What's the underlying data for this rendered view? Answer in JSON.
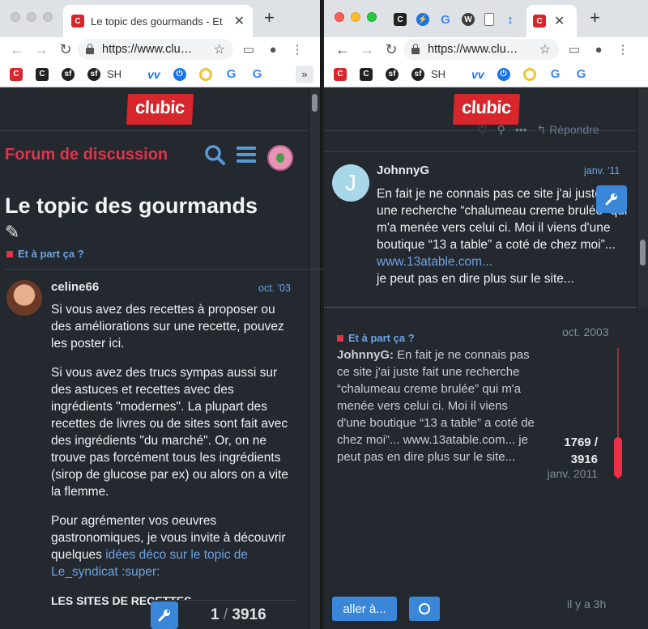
{
  "left_window": {
    "tab_title": "Le topic des gourmands - Et à",
    "url": "https://www.clu…",
    "bookmark_sh": "SH",
    "logo": "clubic",
    "forum_title": "Forum de discussion",
    "topic_title": "Le topic des gourmands",
    "category": "Et à part ça ?",
    "post": {
      "username": "celine66",
      "date": "oct. '03",
      "paragraphs": [
        "Si vous avez des recettes à proposer ou des améliorations sur une recette, pouvez les poster ici.",
        "Si vous avez des trucs sympas aussi sur des astuces et recettes avec des ingrédients \"modernes\". La plupart des recettes de livres ou de sites sont fait avec des ingrédients \"du marché\". Or, on ne trouve pas forcément tous les ingrédients (sirop de glucose par ex) ou alors on a vite la flemme."
      ],
      "p3_text": "Pour agrémenter vos oeuvres gastronomiques, je vous invite à découvrir quelques ",
      "p3_link": "idées déco sur le topic de Le_syndicat :super:",
      "sites_heading": "LES SITES DE RECETTES"
    },
    "progress_current": "1",
    "progress_total": "3916"
  },
  "right_window": {
    "url": "https://www.clu…",
    "bookmark_sh": "SH",
    "logo": "clubic",
    "reply_label": "Répondre",
    "post": {
      "avatar_letter": "J",
      "username": "JohnnyG",
      "date": "janv. '11",
      "text": "En fait je ne connais pas ce site j'ai juste fait une recherche “chalumeau creme brulée” qui m'a menée vers celui ci. Moi il viens d'une boutique “13 a table” a coté de chez moi”...",
      "link": "www.13atable.com...",
      "text2": "je peut pas en dire plus sur le site..."
    },
    "timeline": {
      "category": "Et à part ça ?",
      "start_date": "oct. 2003",
      "excerpt_user": "JohnnyG:",
      "excerpt": "En fait je ne connais pas ce site j'ai juste fait une recherche “chalumeau creme brulée” qui m'a menée vers celui ci. Moi il viens d'une boutique “13 a table” a coté de chez moi”... www.13atable.com... je peut pas en dire plus sur le site...",
      "position": "1769 / 3916",
      "current_date": "janv. 2011",
      "goto_label": "aller à...",
      "ago": "il y a 3h"
    }
  },
  "colors": {
    "accent_red": "#e0344a",
    "link_blue": "#6ca3e3",
    "button_blue": "#3a86d8",
    "bg_dark": "#24292f"
  }
}
